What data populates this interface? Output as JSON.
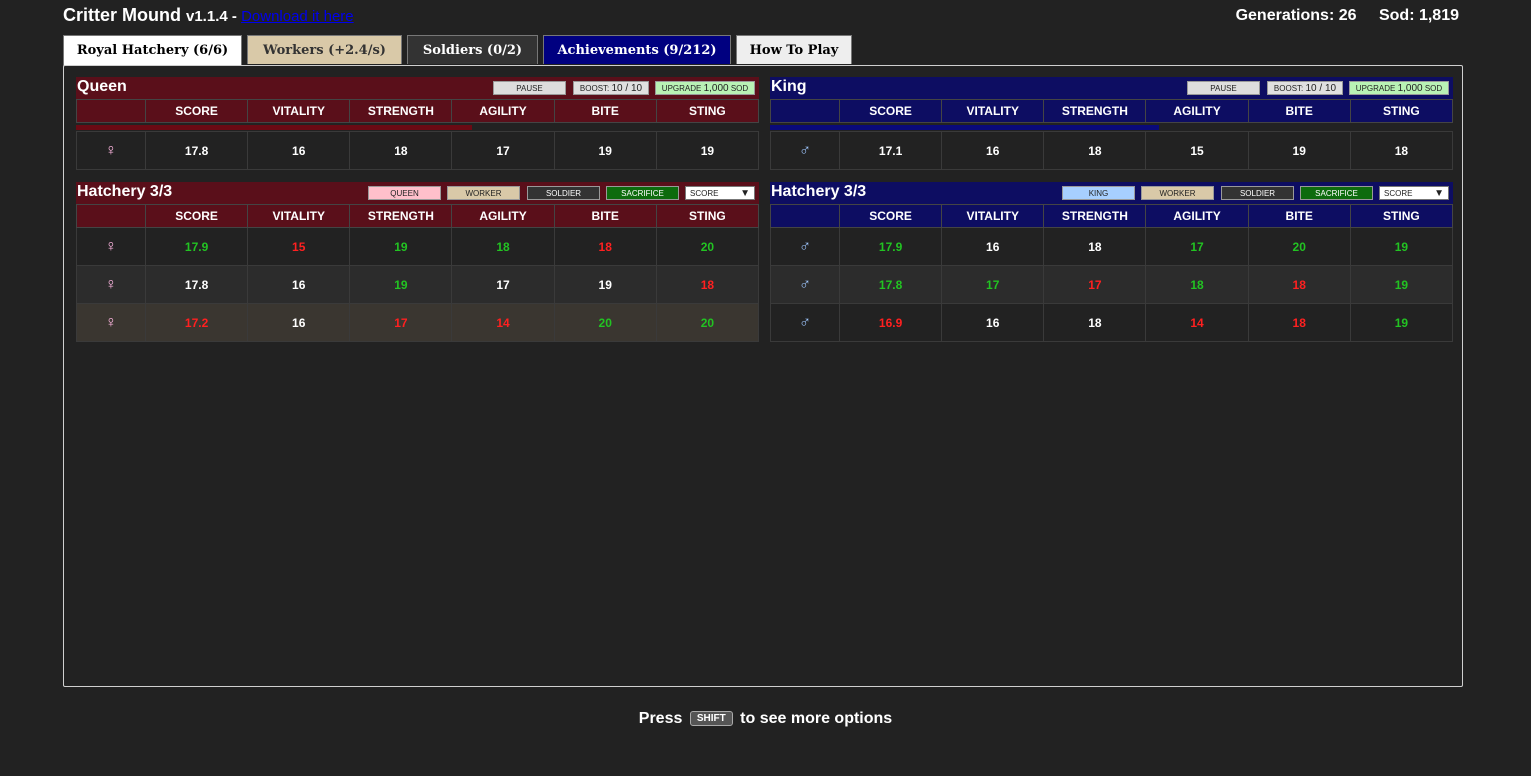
{
  "app": {
    "name": "Critter Mound",
    "version": "v1.1.4",
    "separator": " - ",
    "download_link": "Download it here"
  },
  "stats": {
    "generations": "Generations: 26",
    "sod": "Sod: 1,819"
  },
  "tabs": {
    "hatchery": "Royal Hatchery (6/6)",
    "workers": "Workers (+2.4/s)",
    "soldiers": "Soldiers (0/2)",
    "achievements": "Achievements (9/212)",
    "howto": "How To Play"
  },
  "columns": [
    "SCORE",
    "VITALITY",
    "STRENGTH",
    "AGILITY",
    "BITE",
    "STING"
  ],
  "controls": {
    "pause": "PAUSE",
    "boost_label": "BOOST: ",
    "boost_value": "10 / 10",
    "upgrade_label": "UPGRADE ",
    "upgrade_value": "1,000",
    "upgrade_unit": " SOD",
    "queen_btn": "QUEEN",
    "king_btn": "KING",
    "worker_btn": "WORKER",
    "soldier_btn": "SOLDIER",
    "sacrifice_btn": "SACRIFICE",
    "sort_value": "SCORE"
  },
  "queen": {
    "title": "Queen",
    "symbol": "♀",
    "progress_percent": 58,
    "stats": [
      "17.8",
      "16",
      "18",
      "17",
      "19",
      "19"
    ]
  },
  "king": {
    "title": "King",
    "symbol": "♂",
    "progress_percent": 57,
    "stats": [
      "17.1",
      "16",
      "18",
      "15",
      "19",
      "18"
    ]
  },
  "female_hatchery": {
    "title": "Hatchery 3/3",
    "rows": [
      {
        "symbol": "♀",
        "stats": [
          "17.9",
          "15",
          "19",
          "18",
          "18",
          "20"
        ],
        "dirs": [
          "up",
          "down",
          "up",
          "up",
          "down",
          "up"
        ]
      },
      {
        "symbol": "♀",
        "stats": [
          "17.8",
          "16",
          "19",
          "17",
          "19",
          "18"
        ],
        "dirs": [
          "same",
          "same",
          "up",
          "same",
          "same",
          "down"
        ]
      },
      {
        "symbol": "♀",
        "stats": [
          "17.2",
          "16",
          "17",
          "14",
          "20",
          "20"
        ],
        "dirs": [
          "down",
          "same",
          "down",
          "down",
          "up",
          "up"
        ]
      }
    ]
  },
  "male_hatchery": {
    "title": "Hatchery 3/3",
    "rows": [
      {
        "symbol": "♂",
        "stats": [
          "17.9",
          "16",
          "18",
          "17",
          "20",
          "19"
        ],
        "dirs": [
          "up",
          "same",
          "same",
          "up",
          "up",
          "up"
        ]
      },
      {
        "symbol": "♂",
        "stats": [
          "17.8",
          "17",
          "17",
          "18",
          "18",
          "19"
        ],
        "dirs": [
          "up",
          "up",
          "down",
          "up",
          "down",
          "up"
        ]
      },
      {
        "symbol": "♂",
        "stats": [
          "16.9",
          "16",
          "18",
          "14",
          "18",
          "19"
        ],
        "dirs": [
          "down",
          "same",
          "same",
          "down",
          "down",
          "up"
        ]
      }
    ]
  },
  "footer": {
    "press": "Press",
    "key": "SHIFT",
    "rest": "to see more options"
  }
}
